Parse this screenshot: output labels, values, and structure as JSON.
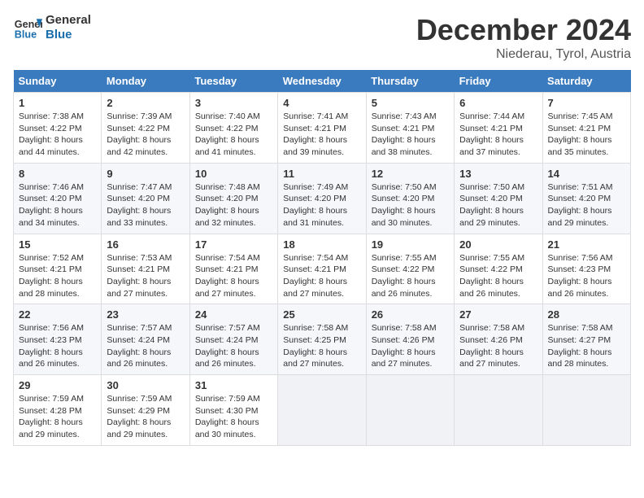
{
  "header": {
    "logo_line1": "General",
    "logo_line2": "Blue",
    "month": "December 2024",
    "location": "Niederau, Tyrol, Austria"
  },
  "weekdays": [
    "Sunday",
    "Monday",
    "Tuesday",
    "Wednesday",
    "Thursday",
    "Friday",
    "Saturday"
  ],
  "weeks": [
    [
      {
        "day": "1",
        "rise": "Sunrise: 7:38 AM",
        "set": "Sunset: 4:22 PM",
        "daylight": "Daylight: 8 hours and 44 minutes."
      },
      {
        "day": "2",
        "rise": "Sunrise: 7:39 AM",
        "set": "Sunset: 4:22 PM",
        "daylight": "Daylight: 8 hours and 42 minutes."
      },
      {
        "day": "3",
        "rise": "Sunrise: 7:40 AM",
        "set": "Sunset: 4:22 PM",
        "daylight": "Daylight: 8 hours and 41 minutes."
      },
      {
        "day": "4",
        "rise": "Sunrise: 7:41 AM",
        "set": "Sunset: 4:21 PM",
        "daylight": "Daylight: 8 hours and 39 minutes."
      },
      {
        "day": "5",
        "rise": "Sunrise: 7:43 AM",
        "set": "Sunset: 4:21 PM",
        "daylight": "Daylight: 8 hours and 38 minutes."
      },
      {
        "day": "6",
        "rise": "Sunrise: 7:44 AM",
        "set": "Sunset: 4:21 PM",
        "daylight": "Daylight: 8 hours and 37 minutes."
      },
      {
        "day": "7",
        "rise": "Sunrise: 7:45 AM",
        "set": "Sunset: 4:21 PM",
        "daylight": "Daylight: 8 hours and 35 minutes."
      }
    ],
    [
      {
        "day": "8",
        "rise": "Sunrise: 7:46 AM",
        "set": "Sunset: 4:20 PM",
        "daylight": "Daylight: 8 hours and 34 minutes."
      },
      {
        "day": "9",
        "rise": "Sunrise: 7:47 AM",
        "set": "Sunset: 4:20 PM",
        "daylight": "Daylight: 8 hours and 33 minutes."
      },
      {
        "day": "10",
        "rise": "Sunrise: 7:48 AM",
        "set": "Sunset: 4:20 PM",
        "daylight": "Daylight: 8 hours and 32 minutes."
      },
      {
        "day": "11",
        "rise": "Sunrise: 7:49 AM",
        "set": "Sunset: 4:20 PM",
        "daylight": "Daylight: 8 hours and 31 minutes."
      },
      {
        "day": "12",
        "rise": "Sunrise: 7:50 AM",
        "set": "Sunset: 4:20 PM",
        "daylight": "Daylight: 8 hours and 30 minutes."
      },
      {
        "day": "13",
        "rise": "Sunrise: 7:50 AM",
        "set": "Sunset: 4:20 PM",
        "daylight": "Daylight: 8 hours and 29 minutes."
      },
      {
        "day": "14",
        "rise": "Sunrise: 7:51 AM",
        "set": "Sunset: 4:20 PM",
        "daylight": "Daylight: 8 hours and 29 minutes."
      }
    ],
    [
      {
        "day": "15",
        "rise": "Sunrise: 7:52 AM",
        "set": "Sunset: 4:21 PM",
        "daylight": "Daylight: 8 hours and 28 minutes."
      },
      {
        "day": "16",
        "rise": "Sunrise: 7:53 AM",
        "set": "Sunset: 4:21 PM",
        "daylight": "Daylight: 8 hours and 27 minutes."
      },
      {
        "day": "17",
        "rise": "Sunrise: 7:54 AM",
        "set": "Sunset: 4:21 PM",
        "daylight": "Daylight: 8 hours and 27 minutes."
      },
      {
        "day": "18",
        "rise": "Sunrise: 7:54 AM",
        "set": "Sunset: 4:21 PM",
        "daylight": "Daylight: 8 hours and 27 minutes."
      },
      {
        "day": "19",
        "rise": "Sunrise: 7:55 AM",
        "set": "Sunset: 4:22 PM",
        "daylight": "Daylight: 8 hours and 26 minutes."
      },
      {
        "day": "20",
        "rise": "Sunrise: 7:55 AM",
        "set": "Sunset: 4:22 PM",
        "daylight": "Daylight: 8 hours and 26 minutes."
      },
      {
        "day": "21",
        "rise": "Sunrise: 7:56 AM",
        "set": "Sunset: 4:23 PM",
        "daylight": "Daylight: 8 hours and 26 minutes."
      }
    ],
    [
      {
        "day": "22",
        "rise": "Sunrise: 7:56 AM",
        "set": "Sunset: 4:23 PM",
        "daylight": "Daylight: 8 hours and 26 minutes."
      },
      {
        "day": "23",
        "rise": "Sunrise: 7:57 AM",
        "set": "Sunset: 4:24 PM",
        "daylight": "Daylight: 8 hours and 26 minutes."
      },
      {
        "day": "24",
        "rise": "Sunrise: 7:57 AM",
        "set": "Sunset: 4:24 PM",
        "daylight": "Daylight: 8 hours and 26 minutes."
      },
      {
        "day": "25",
        "rise": "Sunrise: 7:58 AM",
        "set": "Sunset: 4:25 PM",
        "daylight": "Daylight: 8 hours and 27 minutes."
      },
      {
        "day": "26",
        "rise": "Sunrise: 7:58 AM",
        "set": "Sunset: 4:26 PM",
        "daylight": "Daylight: 8 hours and 27 minutes."
      },
      {
        "day": "27",
        "rise": "Sunrise: 7:58 AM",
        "set": "Sunset: 4:26 PM",
        "daylight": "Daylight: 8 hours and 27 minutes."
      },
      {
        "day": "28",
        "rise": "Sunrise: 7:58 AM",
        "set": "Sunset: 4:27 PM",
        "daylight": "Daylight: 8 hours and 28 minutes."
      }
    ],
    [
      {
        "day": "29",
        "rise": "Sunrise: 7:59 AM",
        "set": "Sunset: 4:28 PM",
        "daylight": "Daylight: 8 hours and 29 minutes."
      },
      {
        "day": "30",
        "rise": "Sunrise: 7:59 AM",
        "set": "Sunset: 4:29 PM",
        "daylight": "Daylight: 8 hours and 29 minutes."
      },
      {
        "day": "31",
        "rise": "Sunrise: 7:59 AM",
        "set": "Sunset: 4:30 PM",
        "daylight": "Daylight: 8 hours and 30 minutes."
      },
      null,
      null,
      null,
      null
    ]
  ]
}
